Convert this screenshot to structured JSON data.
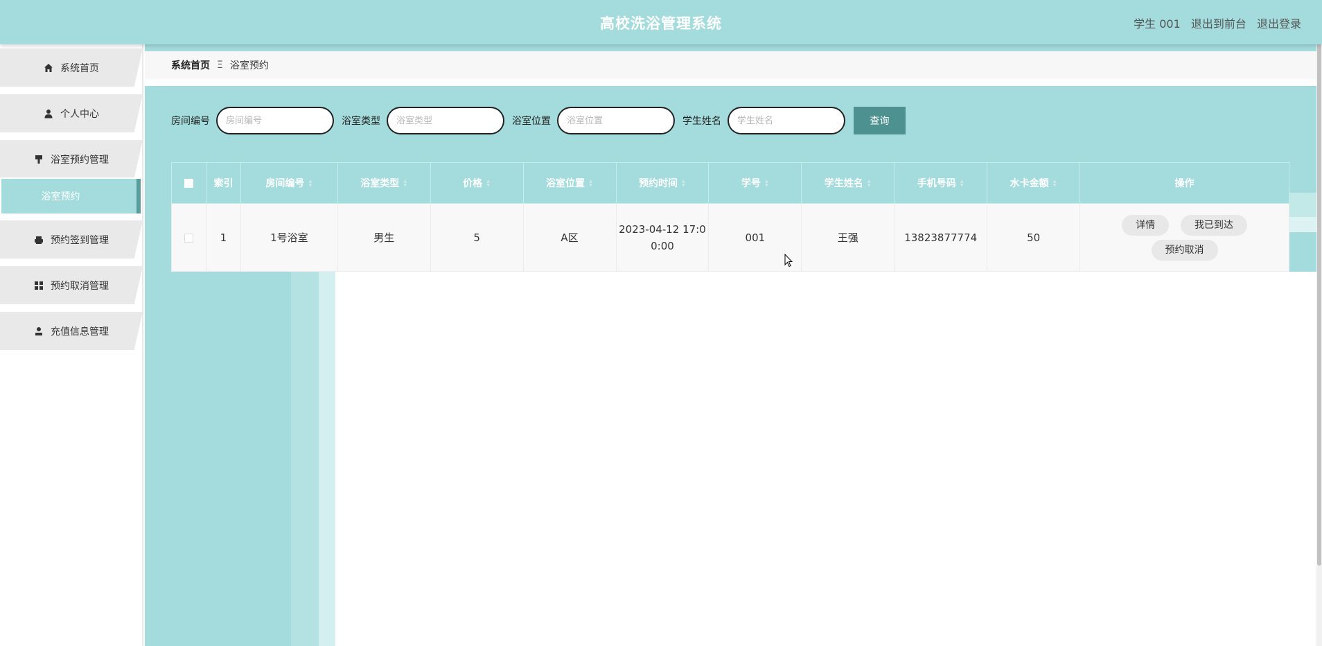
{
  "header": {
    "title": "高校洗浴管理系统",
    "user_label": "学生 001",
    "to_front_label": "退出到前台",
    "logout_label": "退出登录"
  },
  "sidebar": {
    "items": [
      {
        "label": "系统首页",
        "icon": "home-icon"
      },
      {
        "label": "个人中心",
        "icon": "user-icon"
      },
      {
        "label": "浴室预约管理",
        "icon": "brush-icon"
      },
      {
        "label": "预约签到管理",
        "icon": "printer-icon"
      },
      {
        "label": "预约取消管理",
        "icon": "grid-icon"
      },
      {
        "label": "充值信息管理",
        "icon": "person-icon"
      }
    ],
    "sub_item": {
      "label": "浴室预约"
    }
  },
  "breadcrumb": {
    "home": "系统首页",
    "separator": "Ξ",
    "current": "浴室预约"
  },
  "search": {
    "fields": [
      {
        "label": "房间编号",
        "placeholder": "房间编号"
      },
      {
        "label": "浴室类型",
        "placeholder": "浴室类型"
      },
      {
        "label": "浴室位置",
        "placeholder": "浴室位置"
      },
      {
        "label": "学生姓名",
        "placeholder": "学生姓名"
      }
    ],
    "button_label": "查询"
  },
  "table": {
    "columns": [
      "索引",
      "房间编号",
      "浴室类型",
      "价格",
      "浴室位置",
      "预约时间",
      "学号",
      "学生姓名",
      "手机号码",
      "水卡金额",
      "操作"
    ],
    "rows": [
      {
        "index": "1",
        "room_no": "1号浴室",
        "type": "男生",
        "price": "5",
        "location": "A区",
        "time_line1": "2023-04-12 17:0",
        "time_line2": "0:00",
        "student_no": "001",
        "student_name": "王强",
        "phone": "13823877774",
        "card_amount": "50"
      }
    ],
    "actions": {
      "detail": "详情",
      "arrived": "我已到达",
      "cancel": "预约取消"
    }
  },
  "colors": {
    "accent": "#a4dcdd",
    "button": "#4d9190",
    "sidebar_item": "#e9e9e9"
  }
}
